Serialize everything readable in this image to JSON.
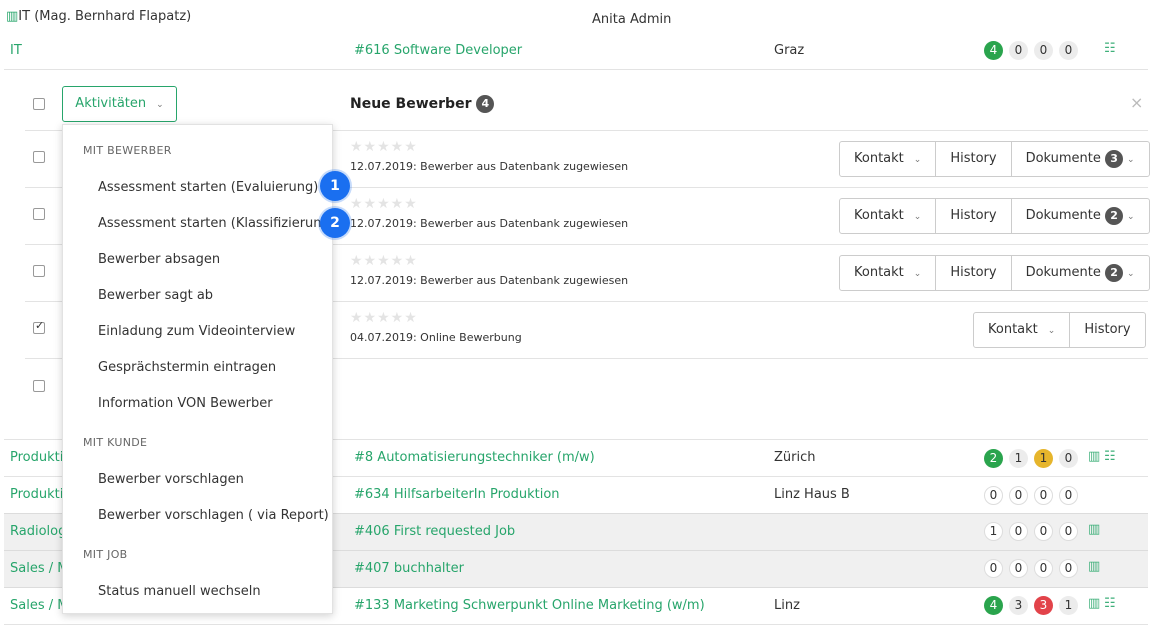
{
  "header": {
    "group_label": "IT (Mag. Bernhard Flapatz)",
    "user": "Anita Admin"
  },
  "top_row": {
    "dept": "IT",
    "job": "#616 Software Developer",
    "location": "Graz",
    "counts": [
      "4",
      "0",
      "0",
      "0"
    ]
  },
  "panel": {
    "activities_label": "Aktivitäten",
    "title": "Neue Bewerber",
    "title_count": "4",
    "close": "×"
  },
  "applicants": [
    {
      "note": "12.07.2019: Bewerber aus Datenbank zugewiesen",
      "kontakt": "Kontakt",
      "history": "History",
      "docs": "Dokumente",
      "docs_count": "3",
      "checked": false
    },
    {
      "note": "12.07.2019: Bewerber aus Datenbank zugewiesen",
      "kontakt": "Kontakt",
      "history": "History",
      "docs": "Dokumente",
      "docs_count": "2",
      "checked": false
    },
    {
      "note": "12.07.2019: Bewerber aus Datenbank zugewiesen",
      "kontakt": "Kontakt",
      "history": "History",
      "docs": "Dokumente",
      "docs_count": "2",
      "checked": false
    },
    {
      "note": "04.07.2019: Online Bewerbung",
      "kontakt": "Kontakt",
      "history": "History",
      "checked": true
    }
  ],
  "stars": "★★★★★",
  "dropdown": {
    "section1": "MIT BEWERBER",
    "items1": [
      "Assessment starten (Evaluierung)",
      "Assessment starten (Klassifizierung)",
      "Bewerber absagen",
      "Bewerber sagt ab",
      "Einladung zum Videointerview",
      "Gesprächstermin eintragen",
      "Information VON Bewerber"
    ],
    "section2": "MIT KUNDE",
    "items2": [
      "Bewerber vorschlagen",
      "Bewerber vorschlagen ( via Report)"
    ],
    "section3": "MIT JOB",
    "items3": [
      "Status manuell wechseln"
    ]
  },
  "markers": [
    "1",
    "2"
  ],
  "job_rows": [
    {
      "dept": "Produkti",
      "job": "#8 Automatisierungstechniker (m/w)",
      "location": "Zürich",
      "counts": [
        "2",
        "1",
        "1",
        "0"
      ]
    },
    {
      "dept": "Produkti",
      "job": "#634 HilfsarbeiterIn Produktion",
      "location": "Linz Haus B",
      "counts": [
        "0",
        "0",
        "0",
        "0"
      ]
    },
    {
      "dept": "Radiolog",
      "job": "#406 First requested Job",
      "location": "",
      "counts": [
        "1",
        "0",
        "0",
        "0"
      ]
    },
    {
      "dept": "Sales / M",
      "job": "#407 buchhalter",
      "location": "",
      "counts": [
        "0",
        "0",
        "0",
        "0"
      ]
    },
    {
      "dept": "Sales / M",
      "job": "#133 Marketing Schwerpunkt Online Marketing (w/m)",
      "location": "Linz",
      "counts": [
        "4",
        "3",
        "3",
        "1"
      ]
    }
  ],
  "colors": {
    "accent": "#27a56b",
    "badge_green": "#2aa44d",
    "badge_yellow": "#e6b52c",
    "badge_red": "#e2434a",
    "marker_blue": "#1a6ff0"
  }
}
